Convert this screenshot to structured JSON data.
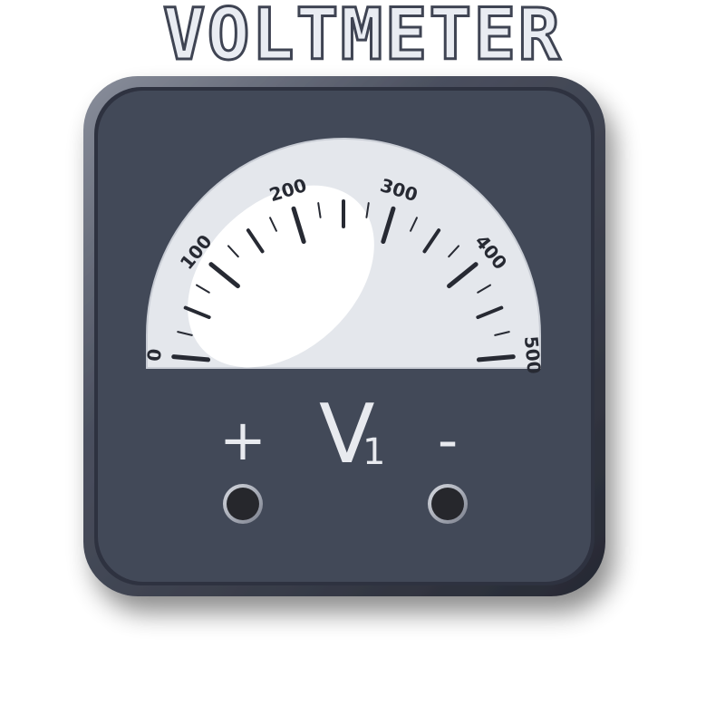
{
  "title": "VOLTMETER",
  "meter": {
    "scale_labels": [
      "0",
      "100",
      "200",
      "300",
      "400",
      "500"
    ],
    "scale_min": 0,
    "scale_max": 500,
    "minor_divisions_between_labels": 4
  },
  "symbol": {
    "letter": "V",
    "subscript": "1"
  },
  "terminals": {
    "positive_label": "+",
    "negative_label": "-"
  },
  "colors": {
    "body": "#434858",
    "body_dark": "#2f3340",
    "dial_face": "#e4e7ec",
    "highlight": "#ffffff",
    "tick": "#272a33",
    "text_light": "#e8eaef"
  }
}
